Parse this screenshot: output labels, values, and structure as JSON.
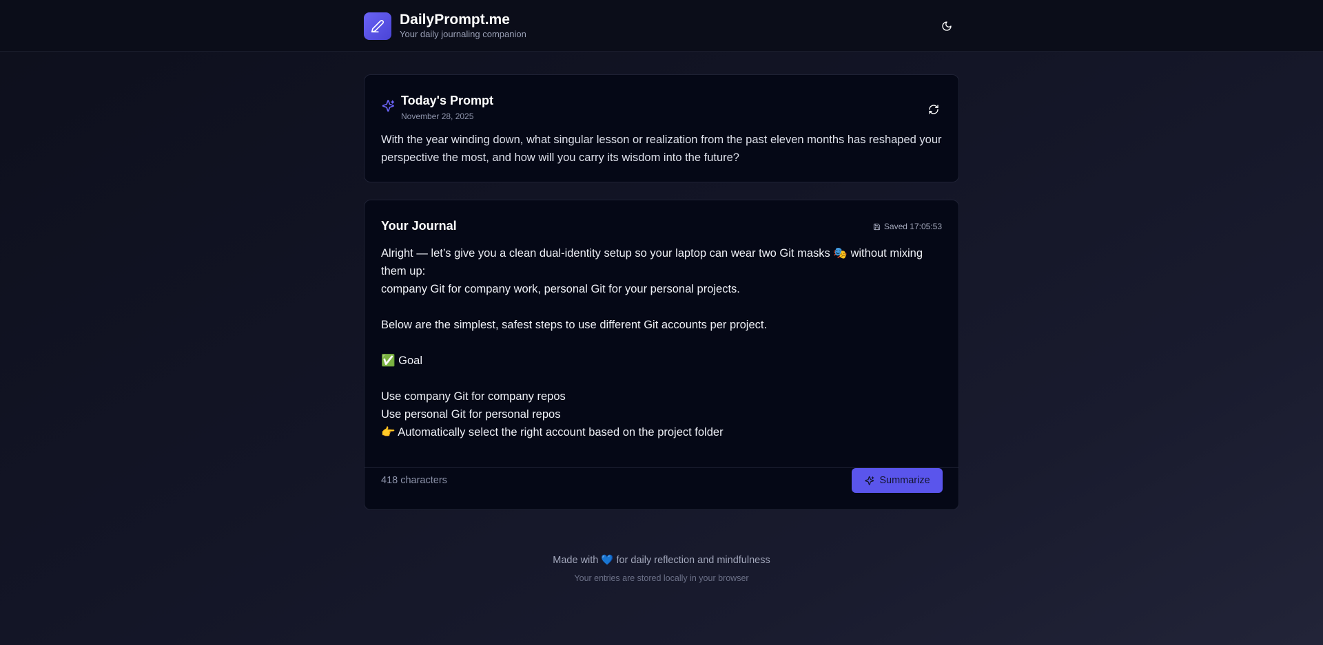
{
  "header": {
    "app_name": "DailyPrompt.me",
    "tagline": "Your daily journaling companion",
    "logo_icon": "pen-icon",
    "theme_icon": "moon-icon"
  },
  "prompt_card": {
    "title": "Today's Prompt",
    "date": "November 28, 2025",
    "text": "With the year winding down, what singular lesson or realization from the past eleven months has reshaped your perspective the most, and how will you carry its wisdom into the future?",
    "refresh_icon": "refresh-icon"
  },
  "journal": {
    "title": "Your Journal",
    "saved_label": "Saved 17:05:53",
    "content": "Alright — let’s give you a clean dual-identity setup so your laptop can wear two Git masks 🎭 without mixing them up:\ncompany Git for company work, personal Git for your personal projects.\n\nBelow are the simplest, safest steps to use different Git accounts per project.\n\n✅ Goal\n\nUse company Git for company repos\nUse personal Git for personal repos\n👉 Automatically select the right account based on the project folder",
    "char_count": "418 characters",
    "summarize_label": "Summarize"
  },
  "footer": {
    "line1": "Made with 💙 for daily reflection and mindfulness",
    "line2": "Your entries are stored locally in your browser"
  },
  "colors": {
    "accent": "#5a55ec",
    "background": "#131526",
    "card": "#050816"
  }
}
